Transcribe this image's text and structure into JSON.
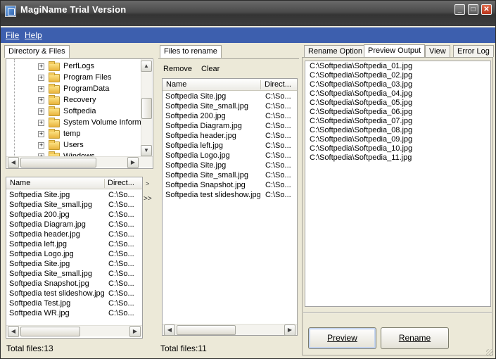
{
  "window": {
    "title": "MagiName Trial Version",
    "accent": "#3d5fae",
    "controls": {
      "minimize": "minimize-icon",
      "maximize": "maximize-icon",
      "close": "close-icon"
    }
  },
  "menu": [
    {
      "label": "File",
      "underline": "F"
    },
    {
      "label": "Help",
      "underline": "H"
    }
  ],
  "left_panel": {
    "tab": "Directory & Files",
    "tree": [
      {
        "label": "PerfLogs"
      },
      {
        "label": "Program Files"
      },
      {
        "label": "ProgramData"
      },
      {
        "label": "Recovery"
      },
      {
        "label": "Softpedia"
      },
      {
        "label": "System Volume Informa"
      },
      {
        "label": "temp"
      },
      {
        "label": "Users"
      },
      {
        "label": "Windows"
      }
    ],
    "columns": [
      "Name",
      "Direct..."
    ],
    "files": [
      {
        "name": "Softpedia Site.jpg",
        "dir": "C:\\So..."
      },
      {
        "name": "Softpedia Site_small.jpg",
        "dir": "C:\\So..."
      },
      {
        "name": "Softpedia 200.jpg",
        "dir": "C:\\So..."
      },
      {
        "name": "Softpedia Diagram.jpg",
        "dir": "C:\\So..."
      },
      {
        "name": "Softpedia header.jpg",
        "dir": "C:\\So..."
      },
      {
        "name": "Softpedia left.jpg",
        "dir": "C:\\So..."
      },
      {
        "name": "Softpedia Logo.jpg",
        "dir": "C:\\So..."
      },
      {
        "name": "Softpedia Site.jpg",
        "dir": "C:\\So..."
      },
      {
        "name": "Softpedia Site_small.jpg",
        "dir": "C:\\So..."
      },
      {
        "name": "Softpedia Snapshot.jpg",
        "dir": "C:\\So..."
      },
      {
        "name": "Softpedia test slideshow.jpg",
        "dir": "C:\\So..."
      },
      {
        "name": "Softpedia Test.jpg",
        "dir": "C:\\So..."
      },
      {
        "name": "Softpedia WR.jpg",
        "dir": "C:\\So..."
      }
    ],
    "status": "Total files:13"
  },
  "splitter": {
    "collapse": ">",
    "add": ">>"
  },
  "middle_panel": {
    "tab": "Files to rename",
    "toolbar": {
      "remove": "Remove",
      "clear": "Clear"
    },
    "columns": [
      "Name",
      "Direct..."
    ],
    "files": [
      {
        "name": "Softpedia Site.jpg",
        "dir": "C:\\So..."
      },
      {
        "name": "Softpedia Site_small.jpg",
        "dir": "C:\\So..."
      },
      {
        "name": "Softpedia 200.jpg",
        "dir": "C:\\So..."
      },
      {
        "name": "Softpedia Diagram.jpg",
        "dir": "C:\\So..."
      },
      {
        "name": "Softpedia header.jpg",
        "dir": "C:\\So..."
      },
      {
        "name": "Softpedia left.jpg",
        "dir": "C:\\So..."
      },
      {
        "name": "Softpedia Logo.jpg",
        "dir": "C:\\So..."
      },
      {
        "name": "Softpedia Site.jpg",
        "dir": "C:\\So..."
      },
      {
        "name": "Softpedia Site_small.jpg",
        "dir": "C:\\So..."
      },
      {
        "name": "Softpedia Snapshot.jpg",
        "dir": "C:\\So..."
      },
      {
        "name": "Softpedia test slideshow.jpg",
        "dir": "C:\\So..."
      }
    ],
    "status": "Total files:11"
  },
  "right_panel": {
    "tabs": [
      "Rename Option",
      "Preview Output",
      "View",
      "Error Log"
    ],
    "active_tab": "Preview Output",
    "preview": [
      "C:\\Softpedia\\Softpedia_01.jpg",
      "C:\\Softpedia\\Softpedia_02.jpg",
      "C:\\Softpedia\\Softpedia_03.jpg",
      "C:\\Softpedia\\Softpedia_04.jpg",
      "C:\\Softpedia\\Softpedia_05.jpg",
      "C:\\Softpedia\\Softpedia_06.jpg",
      "C:\\Softpedia\\Softpedia_07.jpg",
      "C:\\Softpedia\\Softpedia_08.jpg",
      "C:\\Softpedia\\Softpedia_09.jpg",
      "C:\\Softpedia\\Softpedia_10.jpg",
      "C:\\Softpedia\\Softpedia_11.jpg"
    ],
    "buttons": {
      "preview": "Preview",
      "rename": "Rename"
    }
  }
}
